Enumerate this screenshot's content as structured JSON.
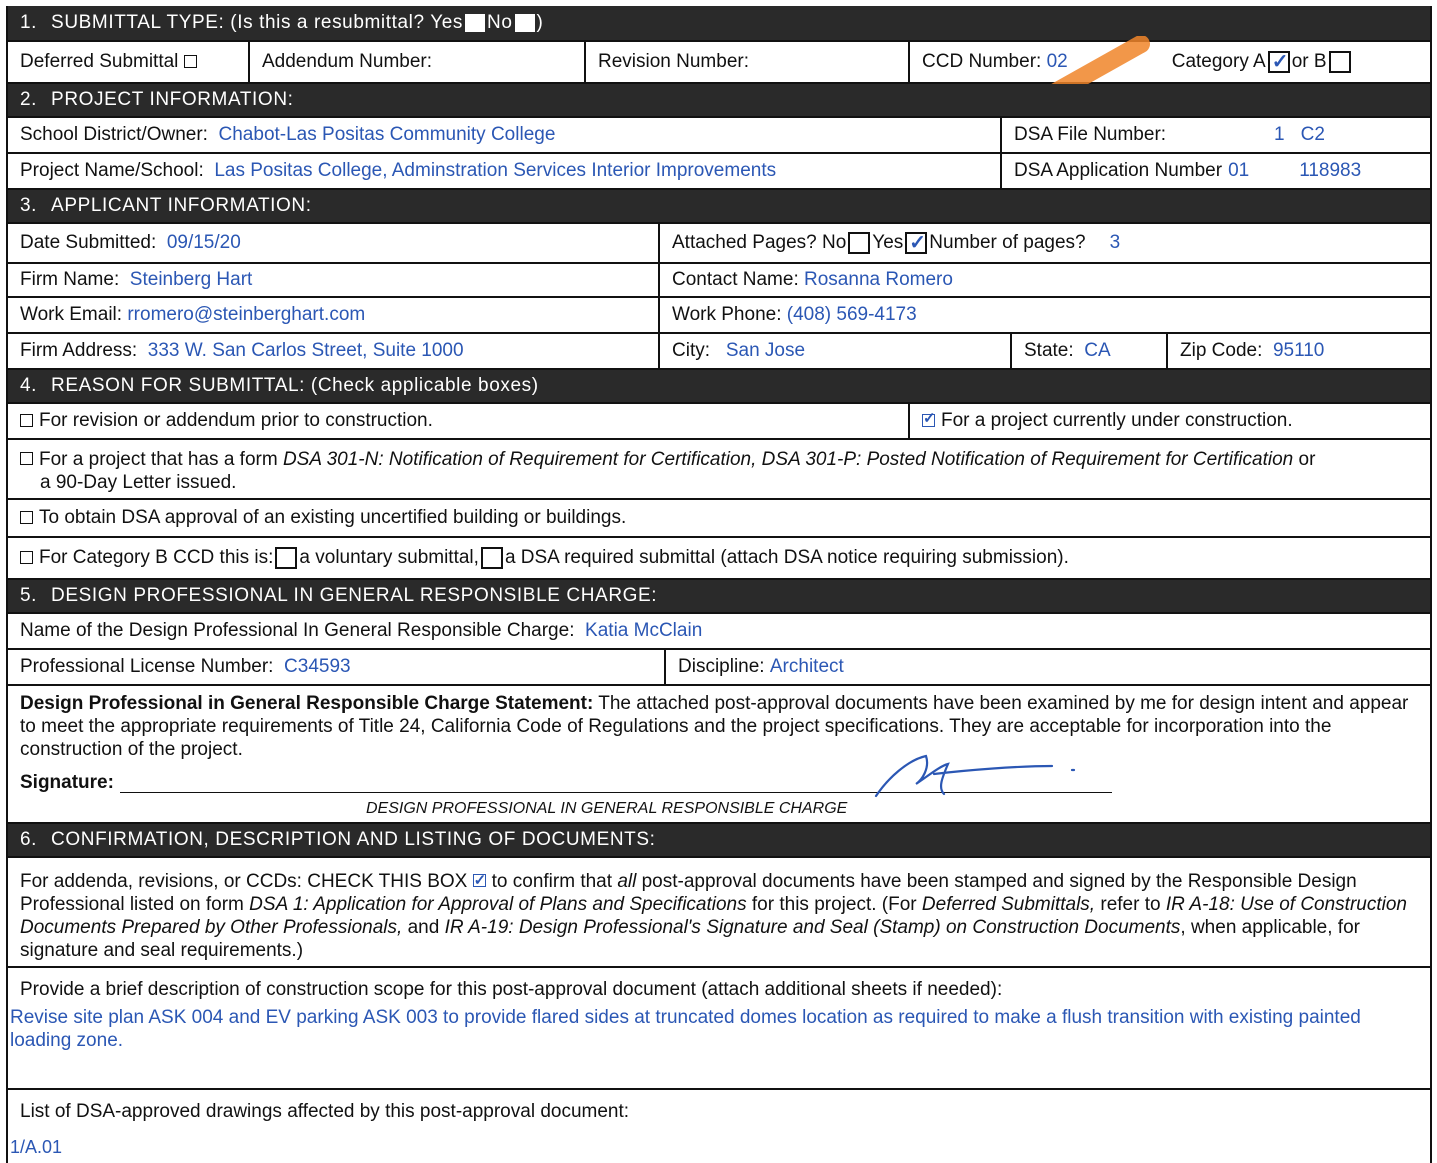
{
  "s1": {
    "num": "1.",
    "title": "SUBMITTAL TYPE:",
    "question": "(Is this a resubmittal? Yes",
    "no": "No",
    "close": ")",
    "deferred": "Deferred Submittal",
    "addendum": "Addendum Number:",
    "revision": "Revision Number:",
    "ccd_label": "CCD Number:",
    "ccd_value": "02",
    "cat_a": "Category A",
    "cat_or_b": "or B"
  },
  "s2": {
    "num": "2.",
    "title": "PROJECT INFORMATION:",
    "district_label": "School District/Owner:",
    "district_value": "Chabot-Las Positas Community College",
    "file_label": "DSA File Number:",
    "file_value_1": "1",
    "file_value_2": "C2",
    "project_label": "Project Name/School:",
    "project_value": "Las  Positas College, Adminstration Services Interior Improvements",
    "app_label": "DSA Application Number",
    "app_value_1": "01",
    "app_value_2": "118983"
  },
  "s3": {
    "num": "3.",
    "title": "APPLICANT INFORMATION:",
    "date_label": "Date Submitted:",
    "date_value": "09/15/20",
    "attached_label": "Attached Pages? No",
    "attached_yes": "Yes",
    "attached_num": "Number of pages?",
    "pages_value": "3",
    "firm_label": "Firm Name:",
    "firm_value": "Steinberg Hart",
    "contact_label": "Contact Name:",
    "contact_value": "Rosanna Romero",
    "email_label": "Work Email:",
    "email_value": "rromero@steinberghart.com",
    "phone_label": "Work Phone:",
    "phone_value": "(408) 569-4173",
    "addr_label": "Firm Address:",
    "addr_value": "333 W. San Carlos Street, Suite 1000",
    "city_label": "City:",
    "city_value": "San Jose",
    "state_label": "State:",
    "state_value": "CA",
    "zip_label": "Zip Code:",
    "zip_value": "95110"
  },
  "s4": {
    "num": "4.",
    "title": "REASON FOR SUBMITTAL: (Check applicable boxes)",
    "opt1": "For revision or addendum prior to construction.",
    "opt2": "For a project currently under construction.",
    "opt3_a": "For a project that has a form",
    "opt3_b": "DSA 301-N: Notification of Requirement for Certification, DSA 301-P: Posted Notification of Requirement for Certification",
    "opt3_c": "or",
    "opt3_d": "a 90-Day Letter issued.",
    "opt4": "To obtain DSA approval of an existing uncertified building or buildings.",
    "opt5_a": "For Category B CCD this is:",
    "opt5_b": "a voluntary submittal,",
    "opt5_c": "a DSA required submittal (attach DSA notice requiring submission)."
  },
  "s5": {
    "num": "5.",
    "title": "DESIGN PROFESSIONAL IN GENERAL RESPONSIBLE CHARGE:",
    "name_label": "Name of the Design Professional In General Responsible Charge:",
    "name_value": "Katia McClain",
    "license_label": "Professional License Number:",
    "license_value": "C34593",
    "discipline_label": "Discipline:",
    "discipline_value": "Architect",
    "statement_bold": "Design Professional in General Responsible Charge Statement:",
    "statement_text": "The attached post-approval documents have been examined by me for design intent and appear to meet the appropriate requirements of Title 24, California Code of Regulations and the project specifications. They are acceptable for incorporation into the construction of the project.",
    "signature_label": "Signature:",
    "signature_caption": "DESIGN PROFESSIONAL IN GENERAL RESPONSIBLE CHARGE"
  },
  "s6": {
    "num": "6.",
    "title": "CONFIRMATION, DESCRIPTION AND LISTING OF DOCUMENTS:",
    "confirm_1": "For addenda, revisions, or CCDs: CHECK THIS BOX",
    "confirm_2": "to confirm that",
    "confirm_all": "all",
    "confirm_3": "post-approval documents have been stamped and signed by the Responsible Design Professional listed on form",
    "confirm_dsa1": "DSA 1: Application for Approval of Plans and Specifications",
    "confirm_4": "for this project. (For",
    "confirm_deferred": "Deferred Submittals,",
    "confirm_5": "refer to",
    "confirm_ir": "IR A-18: Use of Construction Documents Prepared by Other Professionals,",
    "confirm_6": "and",
    "confirm_ir2": "IR A-19: Design Professional's Signature and Seal (Stamp) on Construction Documents",
    "confirm_7": ", when applicable, for signature and seal requirements.)",
    "scope_label": "Provide a brief description of construction scope for this post-approval document (attach additional sheets if needed):",
    "scope_value": "Revise site plan ASK 004 and EV parking ASK 003 to provide flared sides at truncated domes location as required to make a flush transition with existing painted loading zone.",
    "list_label": "List of DSA-approved drawings affected by this post-approval document:",
    "list_value": "1/A.01"
  },
  "colors": {
    "header_bg": "#2a2a2a",
    "value_blue": "#2b57b4",
    "highlighter": "#f0852a"
  }
}
